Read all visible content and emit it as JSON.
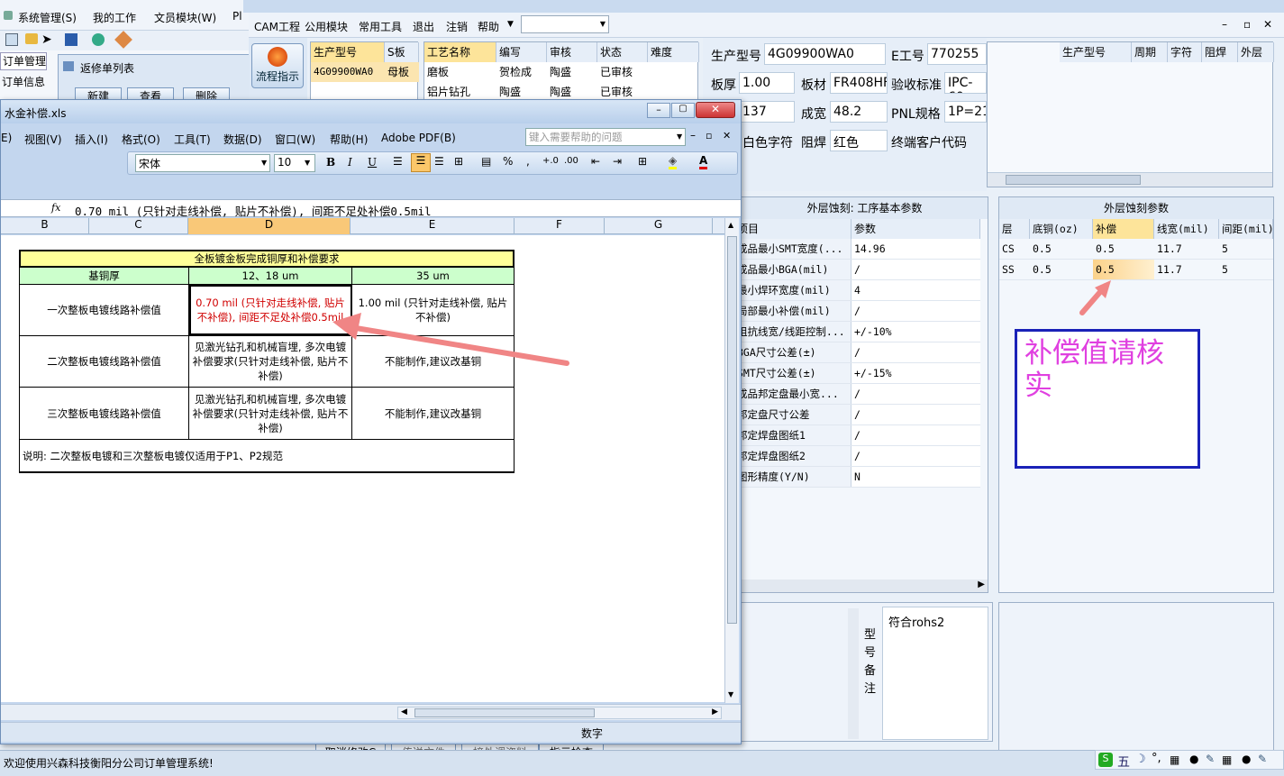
{
  "main_menu": {
    "items": [
      "系统管理(S)",
      "我的工作",
      "文员模块(W)",
      "Pl"
    ]
  },
  "left_panel": {
    "tab_order": "订单管理",
    "order_info": "订单信息",
    "rework_list_title": "返修单列表",
    "btn_new": "新建",
    "btn_view": "查看",
    "btn_delete": "删除"
  },
  "cam_window": {
    "menu": [
      "CAM工程",
      "公用模块",
      "常用工具",
      "退出",
      "注销",
      "帮助"
    ],
    "flow_button": "流程指示"
  },
  "grid_a": {
    "headers": [
      "生产型号",
      "S板"
    ],
    "rows": [
      [
        "4G09900WA0",
        "母板"
      ]
    ]
  },
  "grid_b": {
    "headers": [
      "工艺名称",
      "编写",
      "审核",
      "状态",
      "难度"
    ],
    "rows": [
      [
        "磨板",
        "贺检成",
        "陶盛",
        "已审核"
      ],
      [
        "铝片钻孔",
        "陶盛",
        "陶盛",
        "已审核"
      ]
    ]
  },
  "info": {
    "prod_model_label": "生产型号",
    "prod_model": "4G09900WA0",
    "e_no_label": "E工号",
    "e_no": "770255",
    "thickness_label": "板厚",
    "thickness": "1.00",
    "material_label": "板材",
    "material": "FR408HF",
    "accept_label": "验收标准",
    "accept": "IPC-60",
    "v137": "137",
    "yield_label": "成宽",
    "yield": "48.2",
    "pnl_label": "PNL规格",
    "pnl": "1P=21",
    "silk_label": "白色字符",
    "mask_label": "阻焊",
    "mask": "红色",
    "customer_code_label": "终端客户代码"
  },
  "top_right_grid": {
    "headers": [
      "生产型号",
      "周期",
      "字符",
      "阻焊",
      "外层"
    ]
  },
  "outer_params": {
    "title": "外层蚀刻: 工序基本参数",
    "headers": [
      "项目",
      "参数"
    ],
    "rows": [
      [
        "成品最小SMT宽度(...",
        "14.96"
      ],
      [
        "成品最小BGA(mil)",
        "/"
      ],
      [
        "最小焊环宽度(mil)",
        "4"
      ],
      [
        "局部最小补偿(mil)",
        "/"
      ],
      [
        "阻抗线宽/线距控制...",
        "+/-10%"
      ],
      [
        "BGA尺寸公差(±)",
        "/"
      ],
      [
        "SMT尺寸公差(±)",
        "+/-15%"
      ],
      [
        "成品邦定盘最小宽...",
        "/"
      ],
      [
        "邦定盘尺寸公差",
        "/"
      ],
      [
        "邦定焊盘图纸1",
        "/"
      ],
      [
        "邦定焊盘图纸2",
        "/"
      ],
      [
        "图形精度(Y/N)",
        "N"
      ]
    ]
  },
  "etch_params": {
    "title": "外层蚀刻参数",
    "headers": [
      "层",
      "底铜(oz)",
      "补偿",
      "线宽(mil)",
      "间距(mil)"
    ],
    "rows": [
      [
        "CS",
        "0.5",
        "0.5",
        "11.7",
        "5"
      ],
      [
        "SS",
        "0.5",
        "0.5",
        "11.7",
        "5"
      ]
    ]
  },
  "annotation": {
    "text": "补偿值请核实"
  },
  "remarks": {
    "vertical_label": "型号备注",
    "text": "符合rohs2"
  },
  "bottom_buttons": [
    "取消修改C",
    "传送文件",
    "接外调资料",
    "指示检查"
  ],
  "status_bar": {
    "welcome": "欢迎使用兴森科技衡阳分公司订单管理系统!"
  },
  "excel": {
    "title": "水金补偿.xls",
    "menu": [
      "E)",
      "视图(V)",
      "插入(I)",
      "格式(O)",
      "工具(T)",
      "数据(D)",
      "窗口(W)",
      "帮助(H)",
      "Adobe PDF(B)"
    ],
    "help_placeholder": "键入需要帮助的问题",
    "font_name": "宋体",
    "font_size": "10",
    "formula": "0.70 mil (只针对走线补偿, 贴片不补偿), 间距不足处补偿0.5mil",
    "fx": "fx",
    "columns": [
      "B",
      "C",
      "D",
      "E",
      "F",
      "G"
    ],
    "table_title": "全板镀金板完成铜厚和补偿要求",
    "col_base": "基铜厚",
    "col_12_18": "12、18 um",
    "col_35": "35 um",
    "row1_label": "一次整板电镀线路补偿值",
    "row1_d": "0.70 mil (只针对走线补偿, 贴片不补偿), 间距不足处补偿0.5mil",
    "row1_e": "1.00 mil (只针对走线补偿, 贴片不补偿)",
    "row2_label": "二次整板电镀线路补偿值",
    "row2_d": "见激光钻孔和机械盲埋, 多次电镀补偿要求(只针对走线补偿, 贴片不补偿)",
    "row2_e": "不能制作,建议改基铜",
    "row3_label": "三次整板电镀线路补偿值",
    "row3_d": "见激光钻孔和机械盲埋, 多次电镀补偿要求(只针对走线补偿, 贴片不补偿)",
    "row3_e": "不能制作,建议改基铜",
    "note": "说明: 二次整板电镀和三次整板电镀仅适用于P1、P2规范",
    "status_num": "数字"
  },
  "tray": {
    "ime": "五"
  }
}
